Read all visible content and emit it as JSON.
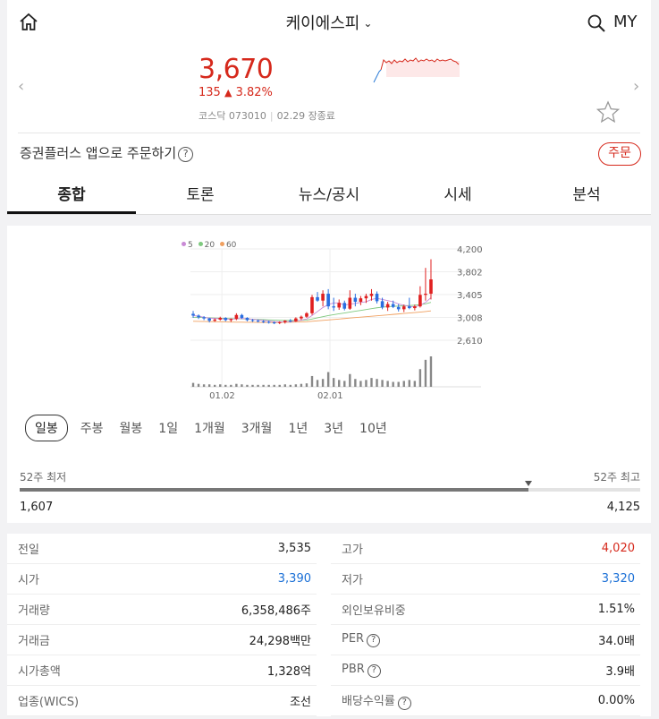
{
  "header": {
    "title": "케이에스피",
    "my_label": "MY"
  },
  "quote": {
    "price": "3,670",
    "change_amount": "135",
    "change_percent": "3.82%",
    "market_code": "코스닥 073010",
    "date_status": "02.29 장종료",
    "color_up": "#d6291c",
    "color_down": "#1a6fd6"
  },
  "promo": {
    "text": "증권플러스 앱으로 주문하기",
    "order_label": "주문"
  },
  "tabs": [
    "종합",
    "토론",
    "뉴스/공시",
    "시세",
    "분석"
  ],
  "chart_data": {
    "type": "candlestick",
    "legend": [
      "5",
      "20",
      "60"
    ],
    "y_ticks": [
      "4,200",
      "3,802",
      "3,405",
      "3,008",
      "2,610"
    ],
    "x_ticks": [
      "01.02",
      "02.01"
    ],
    "ylim": [
      2610,
      4200
    ],
    "candles": [
      [
        3070,
        3120,
        3000,
        3040
      ],
      [
        3040,
        3060,
        2980,
        3010
      ],
      [
        3010,
        3030,
        2960,
        2990
      ],
      [
        2990,
        3000,
        2920,
        2950
      ],
      [
        2950,
        2990,
        2930,
        2970
      ],
      [
        2970,
        3020,
        2950,
        3000
      ],
      [
        3000,
        3010,
        2940,
        2960
      ],
      [
        2960,
        2990,
        2930,
        2980
      ],
      [
        2980,
        3080,
        2960,
        3050
      ],
      [
        3050,
        3070,
        2980,
        3000
      ],
      [
        3000,
        3010,
        2940,
        2960
      ],
      [
        2960,
        2980,
        2930,
        2950
      ],
      [
        2950,
        2970,
        2920,
        2940
      ],
      [
        2940,
        2960,
        2910,
        2930
      ],
      [
        2930,
        2950,
        2900,
        2920
      ],
      [
        2920,
        2940,
        2890,
        2910
      ],
      [
        2910,
        2940,
        2890,
        2925
      ],
      [
        2925,
        2960,
        2900,
        2950
      ],
      [
        2950,
        2980,
        2920,
        2940
      ],
      [
        2940,
        3010,
        2930,
        2990
      ],
      [
        2990,
        3040,
        2960,
        3020
      ],
      [
        3020,
        3100,
        3000,
        3080
      ],
      [
        3080,
        3400,
        3050,
        3360
      ],
      [
        3360,
        3450,
        3280,
        3300
      ],
      [
        3300,
        3480,
        3200,
        3420
      ],
      [
        3420,
        3500,
        3150,
        3200
      ],
      [
        3200,
        3350,
        3120,
        3180
      ],
      [
        3180,
        3320,
        3140,
        3260
      ],
      [
        3260,
        3300,
        3130,
        3160
      ],
      [
        3160,
        3480,
        3140,
        3350
      ],
      [
        3350,
        3420,
        3200,
        3280
      ],
      [
        3280,
        3380,
        3220,
        3340
      ],
      [
        3340,
        3420,
        3260,
        3380
      ],
      [
        3380,
        3500,
        3300,
        3420
      ],
      [
        3420,
        3460,
        3250,
        3290
      ],
      [
        3290,
        3350,
        3150,
        3180
      ],
      [
        3180,
        3280,
        3120,
        3240
      ],
      [
        3240,
        3300,
        3170,
        3190
      ],
      [
        3190,
        3240,
        3110,
        3150
      ],
      [
        3150,
        3230,
        3100,
        3200
      ],
      [
        3200,
        3350,
        3150,
        3170
      ],
      [
        3170,
        3230,
        3130,
        3200
      ],
      [
        3200,
        3550,
        3180,
        3400
      ],
      [
        3400,
        3870,
        3300,
        3420
      ],
      [
        3420,
        4020,
        3320,
        3670
      ]
    ],
    "ma5": [
      3040,
      3030,
      3010,
      2995,
      2990,
      2985,
      2980,
      2975,
      2985,
      2990,
      2985,
      2975,
      2965,
      2955,
      2945,
      2935,
      2930,
      2930,
      2935,
      2945,
      2960,
      2980,
      3040,
      3110,
      3180,
      3230,
      3260,
      3260,
      3220,
      3240,
      3250,
      3270,
      3280,
      3320,
      3340,
      3320,
      3300,
      3280,
      3240,
      3220,
      3200,
      3190,
      3220,
      3270,
      3350
    ],
    "ma20": [
      3010,
      3008,
      3005,
      3000,
      2997,
      2994,
      2990,
      2987,
      2985,
      2983,
      2980,
      2977,
      2974,
      2970,
      2966,
      2962,
      2958,
      2956,
      2955,
      2955,
      2958,
      2962,
      2980,
      3000,
      3020,
      3040,
      3055,
      3070,
      3085,
      3100,
      3115,
      3130,
      3145,
      3160,
      3175,
      3185,
      3195,
      3200,
      3205,
      3210,
      3215,
      3220,
      3230,
      3245,
      3270
    ],
    "ma60": [
      2940,
      2938,
      2936,
      2934,
      2932,
      2930,
      2928,
      2926,
      2925,
      2924,
      2923,
      2922,
      2921,
      2920,
      2920,
      2920,
      2921,
      2922,
      2924,
      2926,
      2929,
      2932,
      2940,
      2948,
      2956,
      2964,
      2972,
      2980,
      2988,
      2996,
      3004,
      3012,
      3020,
      3028,
      3036,
      3044,
      3052,
      3060,
      3068,
      3076,
      3084,
      3092,
      3100,
      3110,
      3122
    ],
    "volume": [
      8,
      6,
      5,
      5,
      4,
      5,
      4,
      4,
      6,
      5,
      4,
      4,
      4,
      4,
      4,
      4,
      4,
      5,
      4,
      5,
      6,
      7,
      22,
      14,
      16,
      30,
      18,
      14,
      12,
      26,
      16,
      12,
      14,
      18,
      16,
      14,
      12,
      10,
      10,
      12,
      14,
      12,
      36,
      55,
      62
    ]
  },
  "periods": [
    "일봉",
    "주봉",
    "월봉",
    "1일",
    "1개월",
    "3개월",
    "1년",
    "3년",
    "10년"
  ],
  "range52": {
    "low_label": "52주 최저",
    "high_label": "52주 최고",
    "low_value": "1,607",
    "high_value": "4,125",
    "current_fraction": 0.82
  },
  "stats": {
    "left": [
      {
        "label": "전일",
        "value": "3,535",
        "tone": ""
      },
      {
        "label": "시가",
        "value": "3,390",
        "tone": "down"
      },
      {
        "label": "거래량",
        "value": "6,358,486주",
        "tone": ""
      },
      {
        "label": "거래금",
        "value": "24,298백만",
        "tone": ""
      },
      {
        "label": "시가총액",
        "value": "1,328억",
        "tone": ""
      },
      {
        "label": "업종(WICS)",
        "value": "조선",
        "tone": ""
      }
    ],
    "right": [
      {
        "label": "고가",
        "value": "4,020",
        "tone": "up",
        "help": false
      },
      {
        "label": "저가",
        "value": "3,320",
        "tone": "down",
        "help": false
      },
      {
        "label": "외인보유비중",
        "value": "1.51%",
        "tone": "",
        "help": false
      },
      {
        "label": "PER",
        "value": "34.0배",
        "tone": "",
        "help": true
      },
      {
        "label": "PBR",
        "value": "3.9배",
        "tone": "",
        "help": true
      },
      {
        "label": "배당수익률",
        "value": "0.00%",
        "tone": "",
        "help": true
      }
    ]
  }
}
